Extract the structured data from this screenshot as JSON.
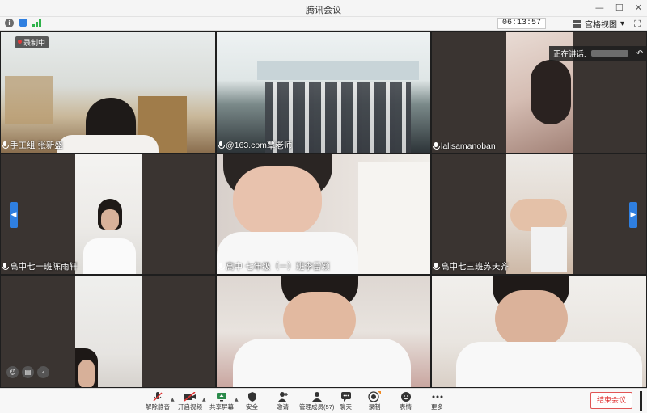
{
  "window": {
    "title": "腾讯会议"
  },
  "infobar": {
    "time": "06:13:57",
    "layout_label": "宫格视图",
    "dropdown_glyph": "▾"
  },
  "recording_badge": "录制中",
  "speaking": {
    "label": "正在讲话:"
  },
  "participants": [
    {
      "name": "手工组 张新盛",
      "mic": true
    },
    {
      "name": "@163.com覃老师",
      "mic": true
    },
    {
      "name": "lalisamanoban",
      "mic": true
    },
    {
      "name": "高中七一班陈雨轩",
      "mic": true
    },
    {
      "name": "高中 七年级（一）班李雷颖",
      "mic": true
    },
    {
      "name": "高中七三班苏天齐",
      "mic": true
    },
    {
      "name": "",
      "mic": false
    },
    {
      "name": "",
      "mic": false
    },
    {
      "name": "",
      "mic": false
    }
  ],
  "toolbar": {
    "unmute": "解除静音",
    "video": "开启视频",
    "share": "共享屏幕",
    "security": "安全",
    "invite": "邀请",
    "members": "管理成员(57)",
    "chat": "聊天",
    "record": "录制",
    "reactions": "表情",
    "more": "更多",
    "end": "结束会议"
  },
  "colors": {
    "accent": "#2f7fe0",
    "end_red": "#e03030",
    "tile_bg": "#3a3431"
  }
}
